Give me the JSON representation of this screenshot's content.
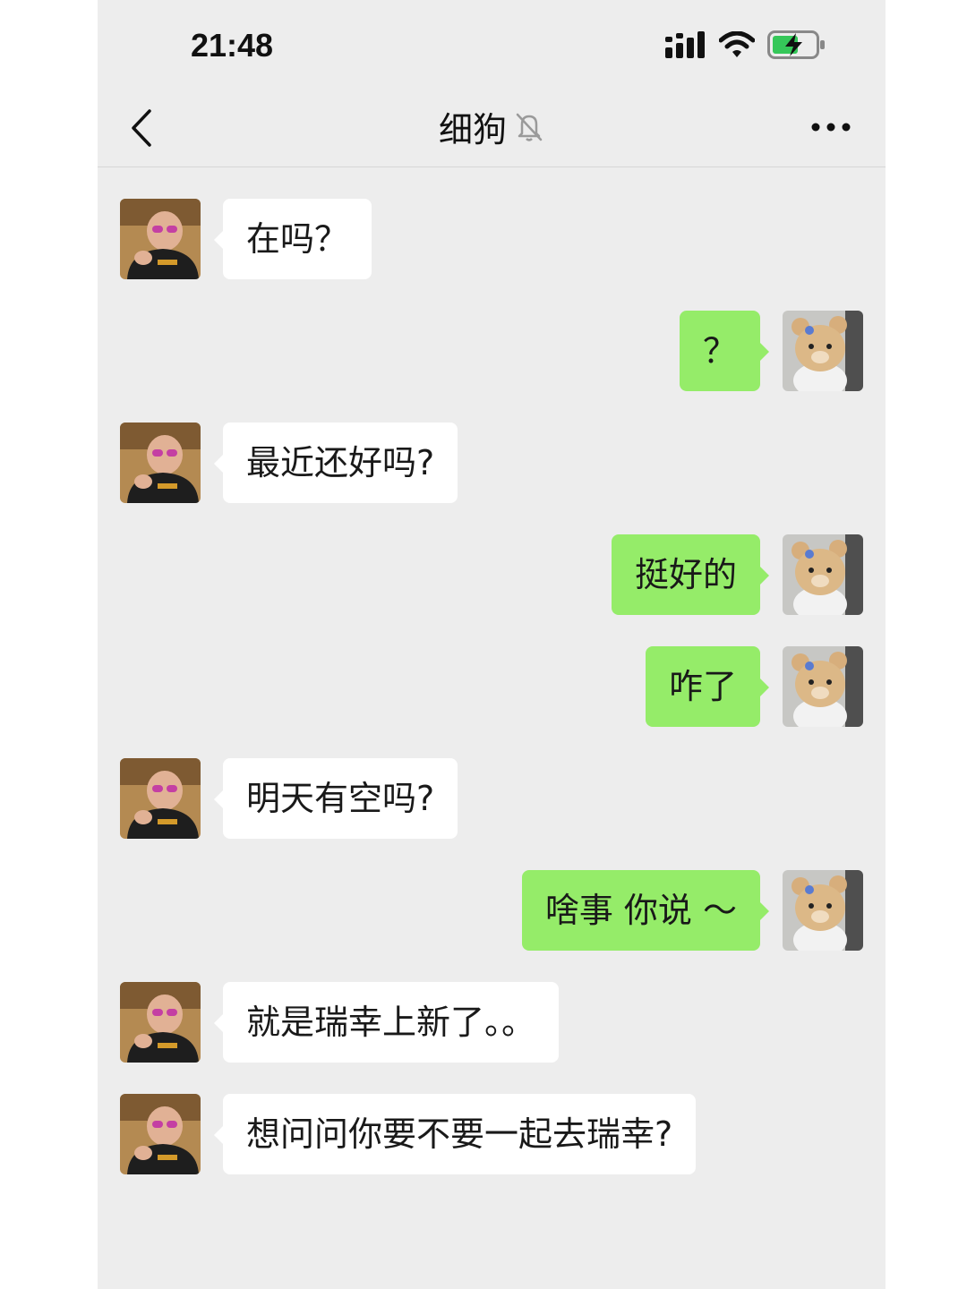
{
  "status_bar": {
    "time": "21:48",
    "icons": [
      "signal-icon",
      "wifi-icon",
      "battery-charging-icon"
    ]
  },
  "header": {
    "title": "细狗",
    "mute_icon": "bell-muted-icon",
    "back_icon": "chevron-left-icon",
    "more_icon": "more-dots-icon"
  },
  "colors": {
    "background": "#ededed",
    "sent_bubble": "#95ec69",
    "received_bubble": "#ffffff"
  },
  "messages": [
    {
      "from": "contact",
      "text": "在吗？"
    },
    {
      "from": "me",
      "text": "？"
    },
    {
      "from": "contact",
      "text": "最近还好吗?"
    },
    {
      "from": "me",
      "text": "挺好的"
    },
    {
      "from": "me",
      "text": "咋了"
    },
    {
      "from": "contact",
      "text": "明天有空吗?"
    },
    {
      "from": "me",
      "text": "啥事 你说 ～"
    },
    {
      "from": "contact",
      "text": "就是瑞幸上新了。。"
    },
    {
      "from": "contact",
      "text": "想问问你要不要一起去瑞幸?"
    }
  ]
}
